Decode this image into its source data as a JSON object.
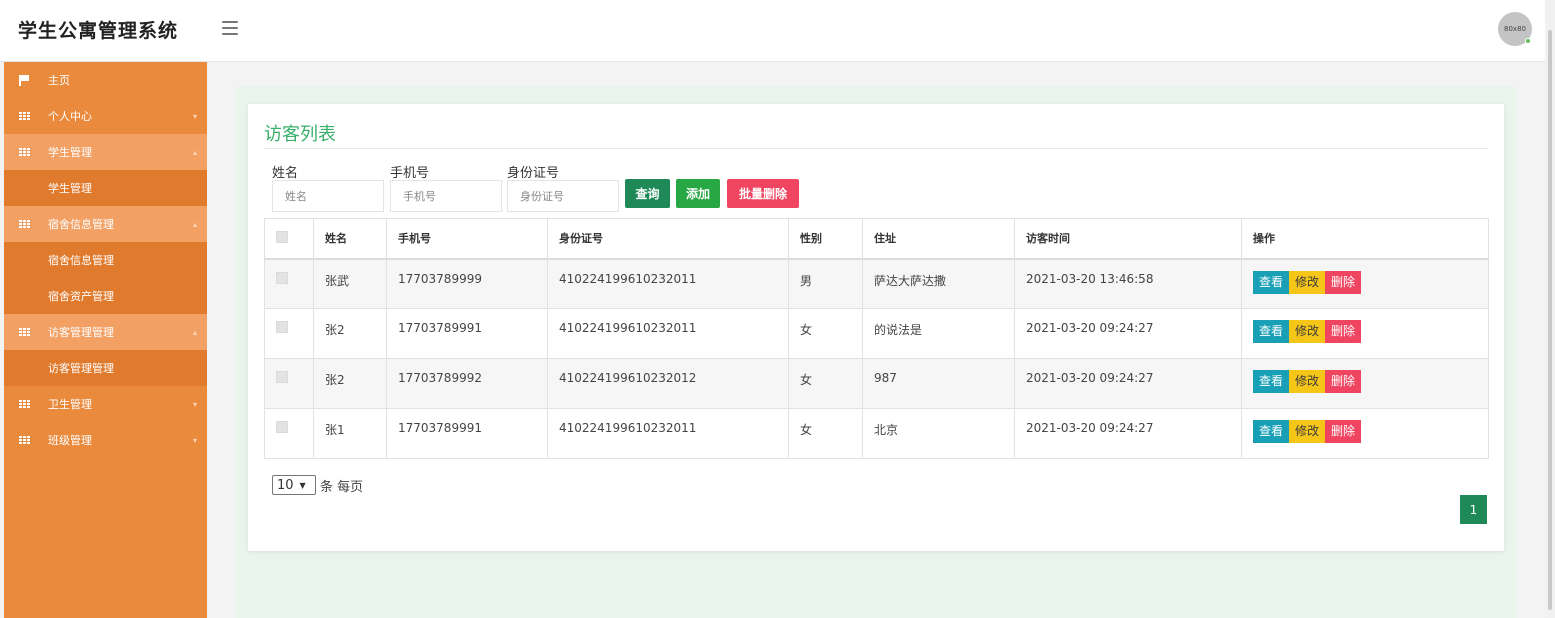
{
  "app": {
    "title": "学生公寓管理系统",
    "avatar_text": "80x80"
  },
  "sidebar": {
    "items": [
      {
        "label": "主页"
      },
      {
        "label": "个人中心"
      },
      {
        "label": "学生管理"
      },
      {
        "label": "学生管理"
      },
      {
        "label": "宿舍信息管理"
      },
      {
        "label": "宿舍信息管理"
      },
      {
        "label": "宿舍资产管理"
      },
      {
        "label": "访客管理管理"
      },
      {
        "label": "访客管理管理"
      },
      {
        "label": "卫生管理"
      },
      {
        "label": "班级管理"
      }
    ]
  },
  "page": {
    "title": "访客列表",
    "search": {
      "name_label": "姓名",
      "name_placeholder": "姓名",
      "phone_label": "手机号",
      "phone_placeholder": "手机号",
      "id_label": "身份证号",
      "id_placeholder": "身份证号",
      "search_btn": "查询",
      "add_btn": "添加",
      "batch_delete_btn": "批量删除"
    },
    "table": {
      "headers": [
        "姓名",
        "手机号",
        "身份证号",
        "性别",
        "住址",
        "访客时间",
        "操作"
      ],
      "rows": [
        [
          "张武",
          "17703789999",
          "410224199610232011",
          "男",
          "萨达大萨达撒",
          "2021-03-20 13:46:58"
        ],
        [
          "张2",
          "17703789991",
          "410224199610232011",
          "女",
          "的说法是",
          "2021-03-20 09:24:27"
        ],
        [
          "张2",
          "17703789992",
          "410224199610232012",
          "女",
          "987",
          "2021-03-20 09:24:27"
        ],
        [
          "张1",
          "17703789991",
          "410224199610232011",
          "女",
          "北京",
          "2021-03-20 09:24:27"
        ]
      ],
      "actions": {
        "view": "查看",
        "edit": "修改",
        "delete": "删除"
      }
    },
    "pagination": {
      "page_size": "10",
      "page_size_suffix": "条 每页",
      "current_page": "1"
    }
  },
  "colors": {
    "sidebar": "#ea8a3c",
    "accent_green": "#1f8a57",
    "title_green": "#3aaf6b",
    "danger": "#ef4560",
    "warning": "#f5c518",
    "info": "#1aa0b6"
  }
}
